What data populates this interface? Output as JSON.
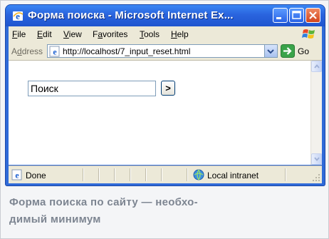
{
  "window": {
    "title": "Форма поиска - Microsoft Internet Ex...",
    "colors": {
      "titlebar": "#2a64de",
      "chrome": "#ece9d8",
      "close": "#d2451d"
    }
  },
  "menu": {
    "items": [
      {
        "prefix": "",
        "accel": "F",
        "suffix": "ile"
      },
      {
        "prefix": "",
        "accel": "E",
        "suffix": "dit"
      },
      {
        "prefix": "",
        "accel": "V",
        "suffix": "iew"
      },
      {
        "prefix": "F",
        "accel": "a",
        "suffix": "vorites"
      },
      {
        "prefix": "",
        "accel": "T",
        "suffix": "ools"
      },
      {
        "prefix": "",
        "accel": "H",
        "suffix": "elp"
      }
    ]
  },
  "address": {
    "label_prefix": "A",
    "label_accel": "d",
    "label_suffix": "dress",
    "url": "http://localhost/7_input_reset.html",
    "go_label": "Go"
  },
  "page": {
    "search_value": "Поиск",
    "submit_label": ">"
  },
  "status": {
    "text": "Done",
    "zone": "Local intranet"
  },
  "caption": {
    "line1": "Форма поиска по сайту — необхо-",
    "line2": "димый минимум"
  },
  "icons": {
    "title": "ie-icon",
    "brand": "windows-flag-icon",
    "page": "ie-page-icon",
    "go": "go-arrow-icon",
    "zone": "intranet-zone-icon"
  }
}
